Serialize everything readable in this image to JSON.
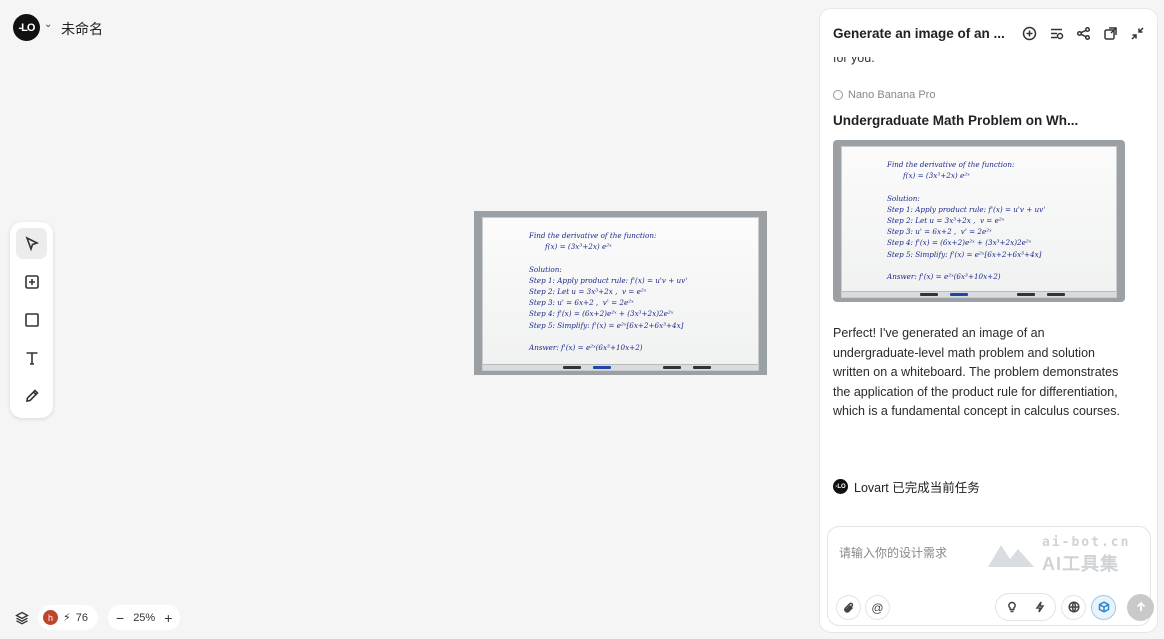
{
  "header": {
    "logo_text": "-LO",
    "project_title": "未命名"
  },
  "toolbar": {
    "tools": [
      {
        "name": "select",
        "icon": "cursor-icon",
        "active": true
      },
      {
        "name": "add-frame",
        "icon": "plus-square-icon",
        "active": false
      },
      {
        "name": "rectangle",
        "icon": "square-icon",
        "active": false
      },
      {
        "name": "text",
        "icon": "text-icon",
        "active": false
      },
      {
        "name": "pen",
        "icon": "pencil-icon",
        "active": false
      }
    ]
  },
  "whiteboard": {
    "text": "Find the derivative of the function:\n       f(x) = (3x³+2x) e²ˣ\n\nSolution:\nStep 1: Apply product rule: f'(x) = u'v + uv'\nStep 2: Let u = 3x³+2x ,  v = e²ˣ\nStep 3: u' = 6x+2 ,  v' = 2e²ˣ\nStep 4: f'(x) = (6x+2)e²ˣ + (3x³+2x)2e²ˣ\nStep 5: Simplify: f'(x) = e²ˣ[6x+2+6x³+4x]\n\nAnswer: f'(x) = e²ˣ(6x³+10x+2)"
  },
  "status": {
    "avatar_letter": "h",
    "credits": "76",
    "zoom": "25%",
    "zoom_out": "−",
    "zoom_in": "+"
  },
  "panel": {
    "title": "Generate an image of an ...",
    "cut_text": "for you.",
    "model": "Nano Banana Pro",
    "result_title": "Undergraduate Math Problem on Wh...",
    "message": "Perfect! I've generated an image of an undergraduate-level math problem and solution written on a whiteboard. The problem demonstrates the application of the product rule for differentiation, which is a fundamental concept in calculus courses.",
    "done_text": "Lovart 已完成当前任务",
    "input_placeholder": "请输入你的设计需求",
    "watermark_url": "ai-bot.cn",
    "watermark_name": "AI工具集"
  }
}
